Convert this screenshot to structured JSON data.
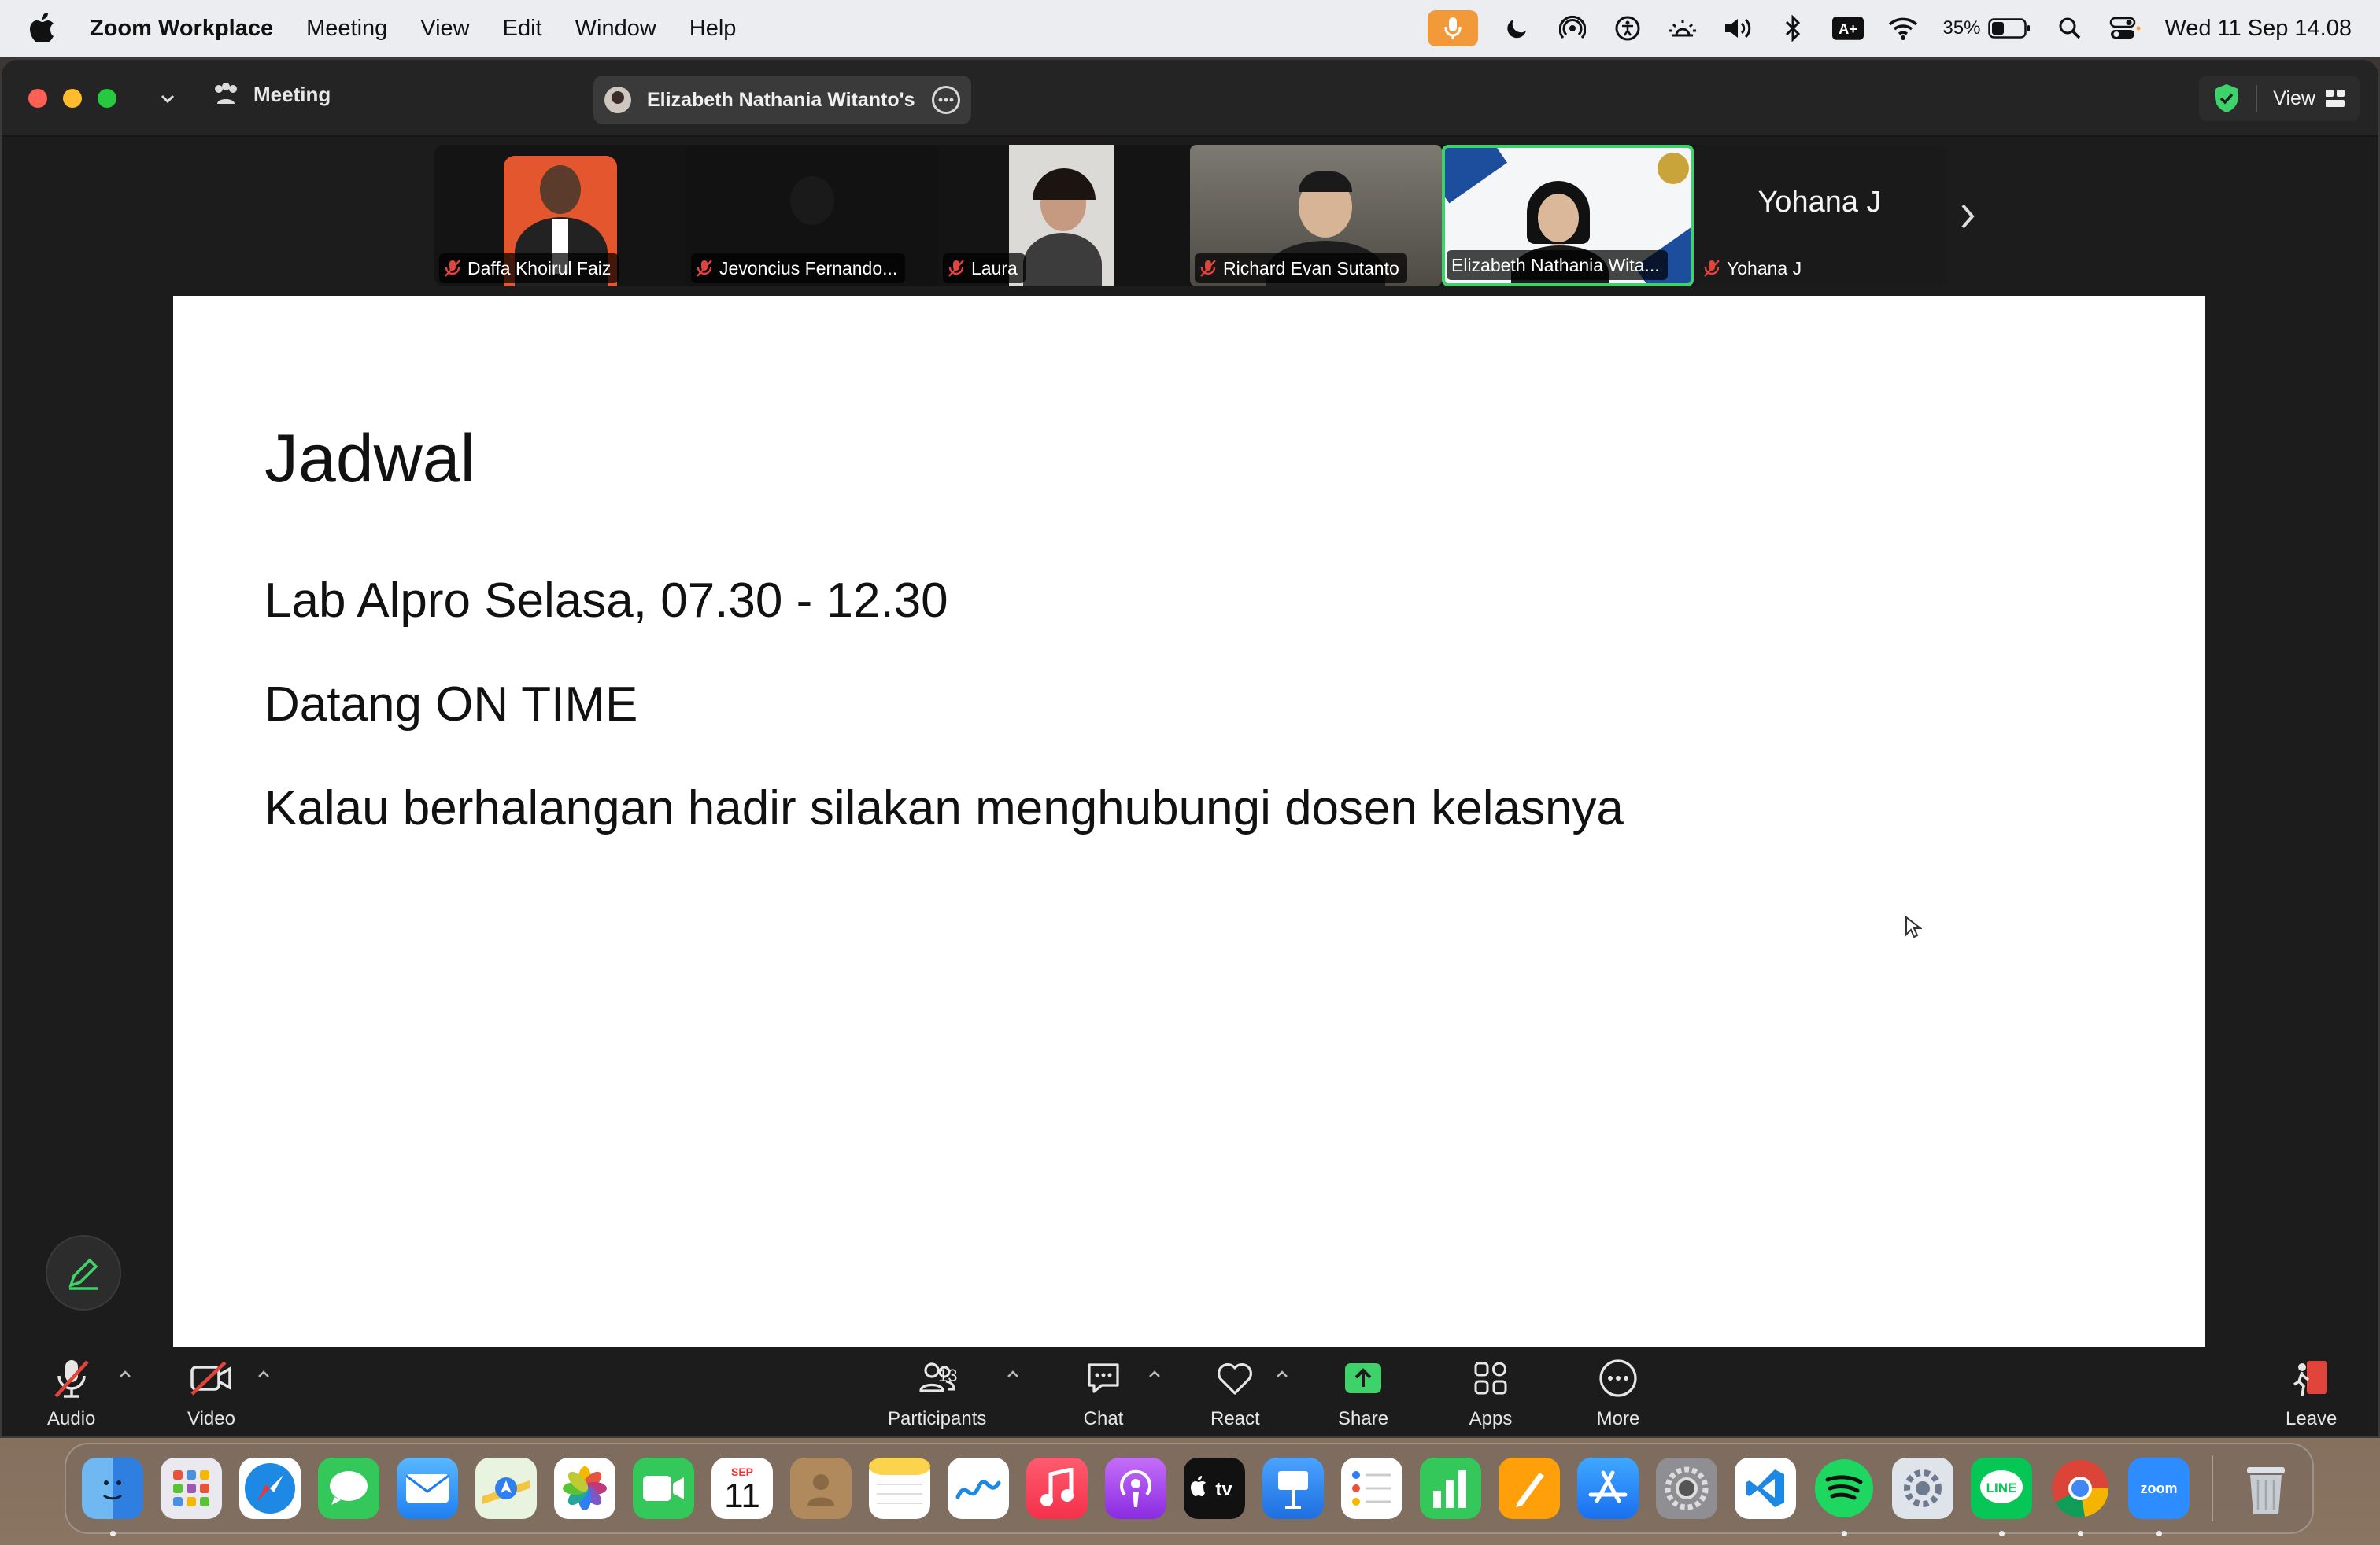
{
  "menubar": {
    "app_name": "Zoom Workplace",
    "menus": [
      "Meeting",
      "View",
      "Edit",
      "Window",
      "Help"
    ],
    "battery_percent": "35%",
    "clock": "Wed 11 Sep  14.08",
    "icons": [
      "microphone-icon",
      "moon-icon",
      "airdrop-icon",
      "accessibility-icon",
      "brightness-icon",
      "volume-icon",
      "bluetooth-icon",
      "keyboard-icon",
      "wifi-icon",
      "battery-icon",
      "search-icon",
      "control-center-icon"
    ],
    "keyboard_badge": "A+"
  },
  "window": {
    "meeting_label": "Meeting",
    "share_title": "Elizabeth Nathania Witanto's",
    "view_label": "View"
  },
  "gallery": {
    "tiles": [
      {
        "name": "Daffa Khoirul Faiz",
        "muted": true
      },
      {
        "name": "Jevoncius Fernando...",
        "muted": true
      },
      {
        "name": "Laura",
        "muted": true
      },
      {
        "name": "Richard Evan Sutanto",
        "muted": true
      },
      {
        "name": "Elizabeth Nathania Wita...",
        "muted": false,
        "active": true
      },
      {
        "name": "Yohana J",
        "muted": true,
        "display_name": "Yohana J"
      }
    ]
  },
  "slide": {
    "title": "Jadwal",
    "lines": [
      "Lab Alpro Selasa, 07.30 - 12.30",
      "Datang ON TIME",
      "Kalau berhalangan hadir silakan menghubungi dosen kelasnya"
    ]
  },
  "toolbar": {
    "audio": "Audio",
    "video": "Video",
    "participants": "Participants",
    "participants_count": "13",
    "chat": "Chat",
    "react": "React",
    "share": "Share",
    "apps": "Apps",
    "more": "More",
    "leave": "Leave"
  },
  "dock": {
    "calendar_month": "SEP",
    "calendar_day": "11",
    "tv_label": "tv",
    "line_label": "LINE",
    "zoom_label": "zoom",
    "apps": [
      "finder",
      "launchpad",
      "safari",
      "messages",
      "mail",
      "maps",
      "photos",
      "facetime",
      "calendar",
      "contacts",
      "notes",
      "freeform",
      "music",
      "podcasts",
      "apple-tv",
      "keynote",
      "reminders",
      "numbers",
      "pages",
      "app-store",
      "system-settings",
      "vscode",
      "spotify",
      "utility",
      "line",
      "chrome",
      "zoom",
      "trash"
    ]
  },
  "colors": {
    "accent_green": "#3ed36a",
    "mute_red": "#e0443a",
    "menubar_bg": "#ecedf1",
    "window_bg": "#1c1c1c"
  }
}
